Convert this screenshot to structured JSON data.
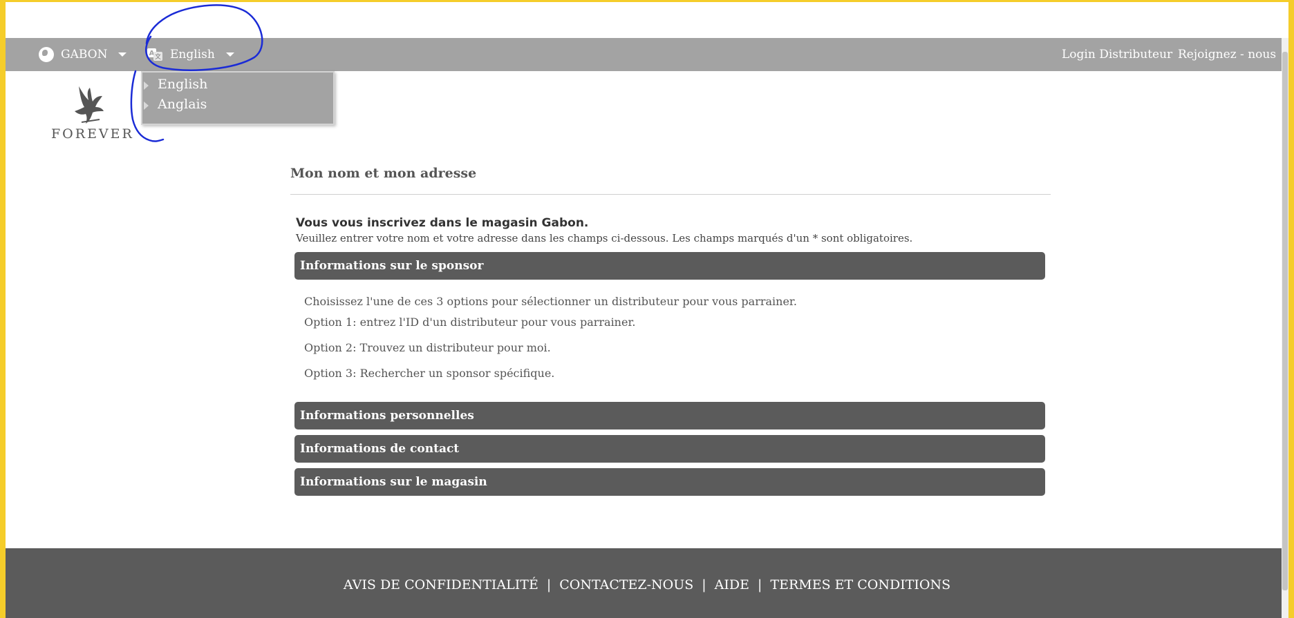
{
  "topbar": {
    "country_label": "GABON",
    "language_label": "English",
    "login_label": "Login Distributeur",
    "join_label": "Rejoignez - nous"
  },
  "language_dropdown": {
    "options": [
      "English",
      "Anglais"
    ]
  },
  "logo": {
    "text": "FOREVER"
  },
  "main": {
    "section_title": "Mon nom et mon adresse",
    "intro_heading": "Vous vous inscrivez dans le magasin Gabon.",
    "intro_text": "Veuillez entrer votre nom et votre adresse dans les champs ci-dessous. Les champs marqués d'un * sont obligatoires.",
    "sponsor_section": {
      "title": "Informations sur le sponsor",
      "lines": [
        "Choisissez l'une de ces 3 options pour sélectionner un distributeur pour vous parrainer.",
        "Option 1: entrez l'ID d'un distributeur pour vous parrainer.",
        "Option 2: Trouvez un distributeur pour moi.",
        "Option 3: Rechercher un sponsor spécifique."
      ]
    },
    "sections": [
      "Informations personnelles",
      "Informations de contact",
      "Informations sur le magasin"
    ]
  },
  "footer": {
    "links": [
      "AVIS DE CONFIDENTIALITÉ",
      "CONTACTEZ-NOUS",
      "AIDE",
      "TERMES ET CONDITIONS"
    ],
    "separator": "|"
  },
  "colors": {
    "frame": "#f5cd2a",
    "topbar": "#a3a3a3",
    "accordion": "#5b5b5b",
    "annotation": "#1a2bd6"
  }
}
